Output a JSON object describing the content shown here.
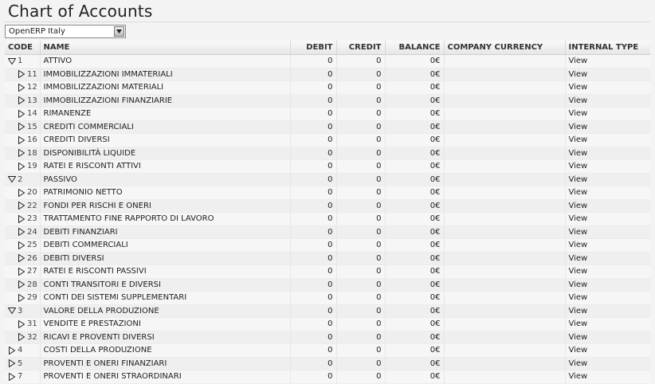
{
  "page": {
    "title": "Chart of Accounts"
  },
  "chart_selector": {
    "value": "OpenERP Italy"
  },
  "columns": [
    {
      "key": "code",
      "label": "CODE"
    },
    {
      "key": "name",
      "label": "NAME"
    },
    {
      "key": "debit",
      "label": "DEBIT"
    },
    {
      "key": "credit",
      "label": "CREDIT"
    },
    {
      "key": "balance",
      "label": "BALANCE"
    },
    {
      "key": "company_currency",
      "label": "COMPANY CURRENCY"
    },
    {
      "key": "internal_type",
      "label": "INTERNAL TYPE"
    }
  ],
  "rows": [
    {
      "code": "1",
      "name": "ATTIVO",
      "level": 0,
      "expanded": true,
      "debit": "0",
      "credit": "0",
      "balance": "0€",
      "company_currency": "",
      "internal_type": "View"
    },
    {
      "code": "11",
      "name": "IMMOBILIZZAZIONI IMMATERIALI",
      "level": 1,
      "expanded": false,
      "debit": "0",
      "credit": "0",
      "balance": "0€",
      "company_currency": "",
      "internal_type": "View"
    },
    {
      "code": "12",
      "name": "IMMOBILIZZAZIONI MATERIALI",
      "level": 1,
      "expanded": false,
      "debit": "0",
      "credit": "0",
      "balance": "0€",
      "company_currency": "",
      "internal_type": "View"
    },
    {
      "code": "13",
      "name": "IMMOBILIZZAZIONI FINANZIARIE",
      "level": 1,
      "expanded": false,
      "debit": "0",
      "credit": "0",
      "balance": "0€",
      "company_currency": "",
      "internal_type": "View"
    },
    {
      "code": "14",
      "name": "RIMANENZE",
      "level": 1,
      "expanded": false,
      "debit": "0",
      "credit": "0",
      "balance": "0€",
      "company_currency": "",
      "internal_type": "View"
    },
    {
      "code": "15",
      "name": "CREDITI COMMERCIALI",
      "level": 1,
      "expanded": false,
      "debit": "0",
      "credit": "0",
      "balance": "0€",
      "company_currency": "",
      "internal_type": "View"
    },
    {
      "code": "16",
      "name": "CREDITI DIVERSI",
      "level": 1,
      "expanded": false,
      "debit": "0",
      "credit": "0",
      "balance": "0€",
      "company_currency": "",
      "internal_type": "View"
    },
    {
      "code": "18",
      "name": "DISPONIBILITÀ LIQUIDE",
      "level": 1,
      "expanded": false,
      "debit": "0",
      "credit": "0",
      "balance": "0€",
      "company_currency": "",
      "internal_type": "View"
    },
    {
      "code": "19",
      "name": "RATEI E RISCONTI ATTIVI",
      "level": 1,
      "expanded": false,
      "debit": "0",
      "credit": "0",
      "balance": "0€",
      "company_currency": "",
      "internal_type": "View"
    },
    {
      "code": "2",
      "name": "PASSIVO",
      "level": 0,
      "expanded": true,
      "debit": "0",
      "credit": "0",
      "balance": "0€",
      "company_currency": "",
      "internal_type": "View"
    },
    {
      "code": "20",
      "name": "PATRIMONIO NETTO",
      "level": 1,
      "expanded": false,
      "debit": "0",
      "credit": "0",
      "balance": "0€",
      "company_currency": "",
      "internal_type": "View"
    },
    {
      "code": "22",
      "name": "FONDI PER RISCHI E ONERI",
      "level": 1,
      "expanded": false,
      "debit": "0",
      "credit": "0",
      "balance": "0€",
      "company_currency": "",
      "internal_type": "View"
    },
    {
      "code": "23",
      "name": "TRATTAMENTO FINE RAPPORTO DI LAVORO",
      "level": 1,
      "expanded": false,
      "debit": "0",
      "credit": "0",
      "balance": "0€",
      "company_currency": "",
      "internal_type": "View"
    },
    {
      "code": "24",
      "name": "DEBITI FINANZIARI",
      "level": 1,
      "expanded": false,
      "debit": "0",
      "credit": "0",
      "balance": "0€",
      "company_currency": "",
      "internal_type": "View"
    },
    {
      "code": "25",
      "name": "DEBITI COMMERCIALI",
      "level": 1,
      "expanded": false,
      "debit": "0",
      "credit": "0",
      "balance": "0€",
      "company_currency": "",
      "internal_type": "View"
    },
    {
      "code": "26",
      "name": "DEBITI DIVERSI",
      "level": 1,
      "expanded": false,
      "debit": "0",
      "credit": "0",
      "balance": "0€",
      "company_currency": "",
      "internal_type": "View"
    },
    {
      "code": "27",
      "name": "RATEI E RISCONTI PASSIVI",
      "level": 1,
      "expanded": false,
      "debit": "0",
      "credit": "0",
      "balance": "0€",
      "company_currency": "",
      "internal_type": "View"
    },
    {
      "code": "28",
      "name": "CONTI TRANSITORI E DIVERSI",
      "level": 1,
      "expanded": false,
      "debit": "0",
      "credit": "0",
      "balance": "0€",
      "company_currency": "",
      "internal_type": "View"
    },
    {
      "code": "29",
      "name": "CONTI DEI SISTEMI SUPPLEMENTARI",
      "level": 1,
      "expanded": false,
      "debit": "0",
      "credit": "0",
      "balance": "0€",
      "company_currency": "",
      "internal_type": "View"
    },
    {
      "code": "3",
      "name": "VALORE DELLA PRODUZIONE",
      "level": 0,
      "expanded": true,
      "debit": "0",
      "credit": "0",
      "balance": "0€",
      "company_currency": "",
      "internal_type": "View"
    },
    {
      "code": "31",
      "name": "VENDITE E PRESTAZIONI",
      "level": 1,
      "expanded": false,
      "debit": "0",
      "credit": "0",
      "balance": "0€",
      "company_currency": "",
      "internal_type": "View"
    },
    {
      "code": "32",
      "name": "RICAVI E PROVENTI DIVERSI",
      "level": 1,
      "expanded": false,
      "debit": "0",
      "credit": "0",
      "balance": "0€",
      "company_currency": "",
      "internal_type": "View"
    },
    {
      "code": "4",
      "name": "COSTI DELLA PRODUZIONE",
      "level": 0,
      "expanded": false,
      "debit": "0",
      "credit": "0",
      "balance": "0€",
      "company_currency": "",
      "internal_type": "View"
    },
    {
      "code": "5",
      "name": "PROVENTI E ONERI FINANZIARI",
      "level": 0,
      "expanded": false,
      "debit": "0",
      "credit": "0",
      "balance": "0€",
      "company_currency": "",
      "internal_type": "View"
    },
    {
      "code": "7",
      "name": "PROVENTI E ONERI STRAORDINARI",
      "level": 0,
      "expanded": false,
      "debit": "0",
      "credit": "0",
      "balance": "0€",
      "company_currency": "",
      "internal_type": "View"
    }
  ]
}
